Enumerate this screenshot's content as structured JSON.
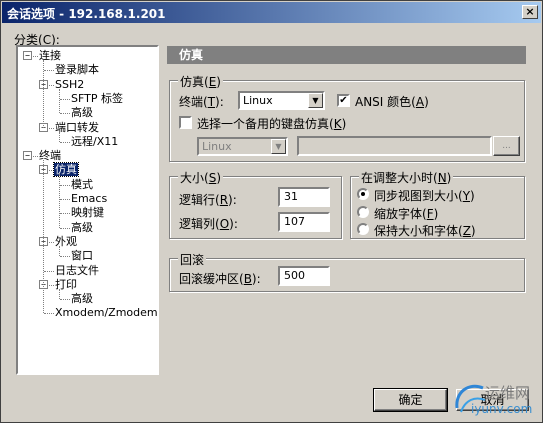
{
  "window": {
    "title": "会话选项 - 192.168.1.201",
    "close_label": "×"
  },
  "category": {
    "label": "分类(",
    "accel": "C",
    "label_end": "):"
  },
  "tree": {
    "items": [
      {
        "label": "连接",
        "level": 0,
        "expander": "−"
      },
      {
        "label": "登录脚本",
        "level": 1
      },
      {
        "label": "SSH2",
        "level": 1,
        "expander": "−"
      },
      {
        "label": "SFTP 标签",
        "level": 2
      },
      {
        "label": "高级",
        "level": 2
      },
      {
        "label": "端口转发",
        "level": 1,
        "expander": "−"
      },
      {
        "label": "远程/X11",
        "level": 2
      },
      {
        "label": "终端",
        "level": 0,
        "expander": "−"
      },
      {
        "label": "仿真",
        "level": 1,
        "expander": "−",
        "selected": true
      },
      {
        "label": "模式",
        "level": 2
      },
      {
        "label": "Emacs",
        "level": 2
      },
      {
        "label": "映射键",
        "level": 2
      },
      {
        "label": "高级",
        "level": 2
      },
      {
        "label": "外观",
        "level": 1,
        "expander": "−"
      },
      {
        "label": "窗口",
        "level": 2
      },
      {
        "label": "日志文件",
        "level": 1
      },
      {
        "label": "打印",
        "level": 1,
        "expander": "−"
      },
      {
        "label": "高级",
        "level": 2
      },
      {
        "label": "Xmodem/Zmodem",
        "level": 1
      }
    ]
  },
  "panel": {
    "header": "仿真"
  },
  "emulation": {
    "group_label": "仿真(",
    "group_accel": "E",
    "group_end": ")",
    "terminal_label": "终端(",
    "terminal_accel": "T",
    "terminal_end": "):",
    "terminal_value": "Linux",
    "ansi_label": "ANSI 颜色(",
    "ansi_accel": "A",
    "ansi_end": ")",
    "ansi_checked": true,
    "alt_kbd_label": "选择一个备用的键盘仿真(",
    "alt_kbd_accel": "K",
    "alt_kbd_end": ")",
    "alt_kbd_checked": false,
    "alt_kbd_value": "Linux",
    "browse_label": "..."
  },
  "size": {
    "group_label": "大小(",
    "group_accel": "S",
    "group_end": ")",
    "rows_label": "逻辑行(",
    "rows_accel": "R",
    "rows_end": "):",
    "rows_value": "31",
    "cols_label": "逻辑列(",
    "cols_accel": "O",
    "cols_end": "):",
    "cols_value": "107"
  },
  "resize": {
    "group_label": "在调整大小时(",
    "group_accel": "N",
    "group_end": ")",
    "options": [
      {
        "label": "同步视图到大小(",
        "accel": "Y",
        "end": ")",
        "checked": true
      },
      {
        "label": "缩放字体(",
        "accel": "F",
        "end": ")",
        "checked": false
      },
      {
        "label": "保持大小和字体(",
        "accel": "Z",
        "end": ")",
        "checked": false
      }
    ]
  },
  "scrollback": {
    "group_label": "回滚",
    "buffer_label": "回滚缓冲区(",
    "buffer_accel": "B",
    "buffer_end": "):",
    "buffer_value": "500"
  },
  "buttons": {
    "ok": "确定",
    "cancel": "取消"
  },
  "watermark": {
    "line1": "运维网",
    "line2": "iyunv.com"
  }
}
